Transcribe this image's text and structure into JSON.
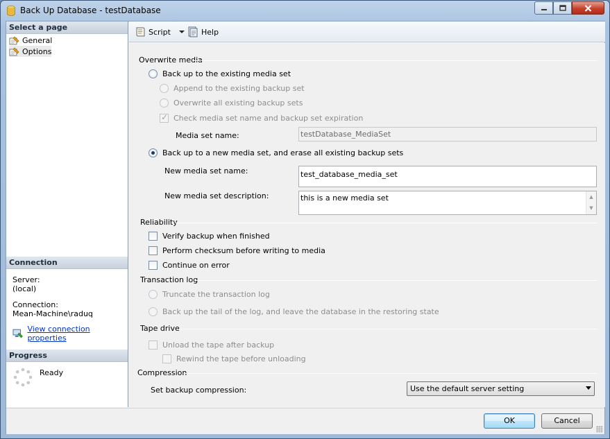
{
  "window": {
    "title": "Back Up Database - testDatabase"
  },
  "left": {
    "select_page_header": "Select a page",
    "pages": [
      {
        "label": "General"
      },
      {
        "label": "Options"
      }
    ],
    "connection_header": "Connection",
    "server_label": "Server:",
    "server_value": "(local)",
    "connection_label": "Connection:",
    "connection_value": "Mean-Machine\\raduq",
    "view_connection_link": "View connection properties",
    "progress_header": "Progress",
    "progress_status": "Ready"
  },
  "toolbar": {
    "script_label": "Script",
    "help_label": "Help"
  },
  "overwrite": {
    "title": "Overwrite media",
    "existing_set": "Back up to the existing media set",
    "append": "Append to the existing backup set",
    "overwrite_all": "Overwrite all existing backup sets",
    "check_expiration": "Check media set name and backup set expiration",
    "media_set_name_label": "Media set name:",
    "media_set_name_value": "testDatabase_MediaSet",
    "new_set": "Back up to a new media set, and erase all existing backup sets",
    "new_name_label": "New media set name:",
    "new_name_value": "test_database_media_set",
    "new_desc_label": "New media set description:",
    "new_desc_value": "this is a new media set"
  },
  "reliability": {
    "title": "Reliability",
    "verify": "Verify backup when finished",
    "checksum": "Perform checksum before writing to media",
    "continue_on_error": "Continue on error"
  },
  "transaction_log": {
    "title": "Transaction log",
    "truncate": "Truncate the transaction log",
    "tail": "Back up the tail of the log, and leave the database in the restoring state"
  },
  "tape": {
    "title": "Tape drive",
    "unload": "Unload the tape after backup",
    "rewind": "Rewind the tape before unloading"
  },
  "compression": {
    "title": "Compression",
    "label": "Set backup compression:",
    "value": "Use the default server setting"
  },
  "buttons": {
    "ok": "OK",
    "cancel": "Cancel"
  },
  "colors": {
    "link": "#0033cc",
    "title_bar": "#bfd3ea",
    "close_button": "#c4412a"
  }
}
